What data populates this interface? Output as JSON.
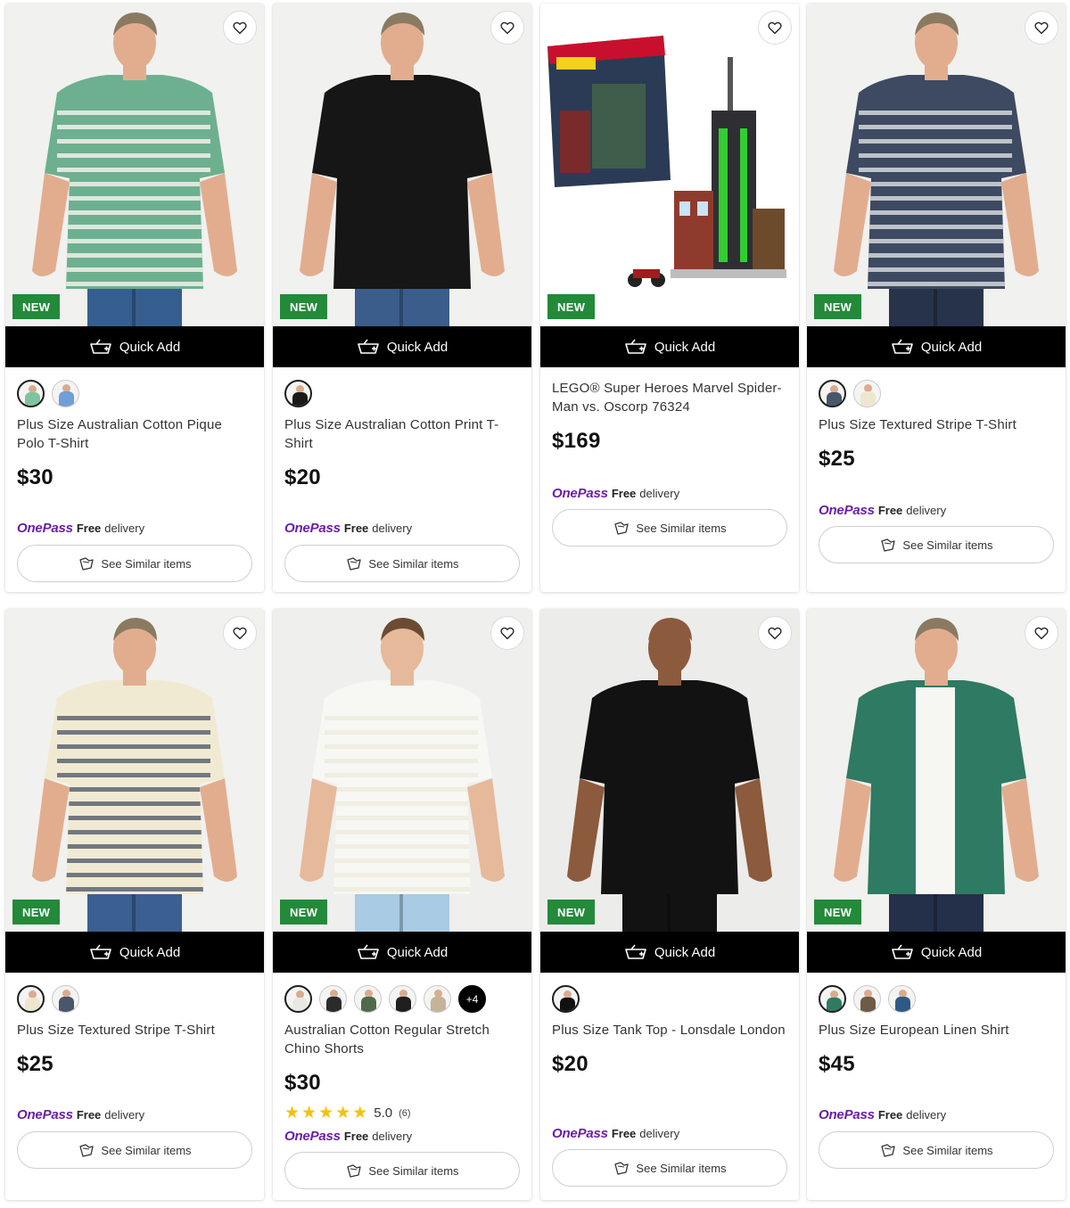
{
  "common": {
    "quick_add_label": "Quick Add",
    "badge_label": "NEW",
    "onepass_logo": "OnePass",
    "onepass_free": "Free",
    "onepass_delivery": "delivery",
    "see_similar_label": "See Similar items"
  },
  "products": [
    {
      "title": "Plus Size Australian Cotton Pique Polo T-Shirt",
      "price": "$30",
      "badge": true,
      "swatches": [
        "#7fc3a0",
        "#6f9fd6"
      ],
      "more_swatches": ""
    },
    {
      "title": "Plus Size Australian Cotton Print T-Shirt",
      "price": "$20",
      "badge": true,
      "swatches": [
        "#1a1a1a"
      ],
      "more_swatches": ""
    },
    {
      "title": "LEGO® Super Heroes Marvel Spider-Man vs. Oscorp 76324",
      "price": "$169",
      "badge": true,
      "swatches": [],
      "more_swatches": ""
    },
    {
      "title": "Plus Size Textured Stripe T-Shirt",
      "price": "$25",
      "badge": true,
      "swatches": [
        "#4a5669",
        "#efe6cf"
      ],
      "more_swatches": ""
    },
    {
      "title": "Plus Size Textured Stripe T-Shirt",
      "price": "$25",
      "badge": true,
      "swatches": [
        "#efe6cf",
        "#4a5669"
      ],
      "more_swatches": ""
    },
    {
      "title": "Australian Cotton Regular Stretch Chino Shorts",
      "price": "$30",
      "badge": true,
      "swatches": [
        "#e9e9e4",
        "#2b2b2b",
        "#4e6a4b",
        "#1f1f1f",
        "#c7b39a"
      ],
      "more_swatches": "+4",
      "rating": {
        "value": "5.0",
        "count": "(6)"
      }
    },
    {
      "title": "Plus Size Tank Top - Lonsdale London",
      "price": "$20",
      "badge": true,
      "swatches": [
        "#111111"
      ],
      "more_swatches": ""
    },
    {
      "title": "Plus Size European Linen Shirt",
      "price": "$45",
      "badge": true,
      "swatches": [
        "#2e7b62",
        "#6d5b47",
        "#2f5a86"
      ],
      "more_swatches": ""
    }
  ],
  "images": [
    {
      "kind": "person",
      "shirt": "#6db08f",
      "trim": "#f1f1ec",
      "pants": "#355e8f",
      "skin": "#e2ad8e",
      "hair": "#8a7a62",
      "bg": "#f1f1ef"
    },
    {
      "kind": "person",
      "shirt": "#161616",
      "trim": "#161616",
      "pants": "#3a5d8c",
      "skin": "#e2ad8e",
      "hair": "#8a7a62",
      "bg": "#f1f1ef"
    },
    {
      "kind": "lego",
      "bg": "#ffffff"
    },
    {
      "kind": "person",
      "shirt": "#3d4a61",
      "trim": "#d5d8dd",
      "pants": "#26334a",
      "skin": "#e2ad8e",
      "hair": "#8a7a62",
      "bg": "#f1f1ef"
    },
    {
      "kind": "person",
      "shirt": "#f1ead2",
      "trim": "#5c6472",
      "pants": "#3b5f90",
      "skin": "#e2ad8e",
      "hair": "#8a7a62",
      "bg": "#f1f1ef"
    },
    {
      "kind": "person",
      "shirt": "#f7f7f4",
      "trim": "#eeebde",
      "pants": "#a9cbe4",
      "skin": "#e6b99a",
      "hair": "#6b4c33",
      "bg": "#efefed"
    },
    {
      "kind": "person",
      "shirt": "#121212",
      "trim": "#121212",
      "pants": "#121212",
      "skin": "#8c5a3c",
      "hair": "#8c5a3c",
      "bg": "#ececea"
    },
    {
      "kind": "person",
      "shirt": "#2f7a62",
      "trim": "#f6f6f2",
      "pants": "#24304a",
      "skin": "#e2ad8e",
      "hair": "#8a7a62",
      "bg": "#f1f1ef"
    }
  ]
}
